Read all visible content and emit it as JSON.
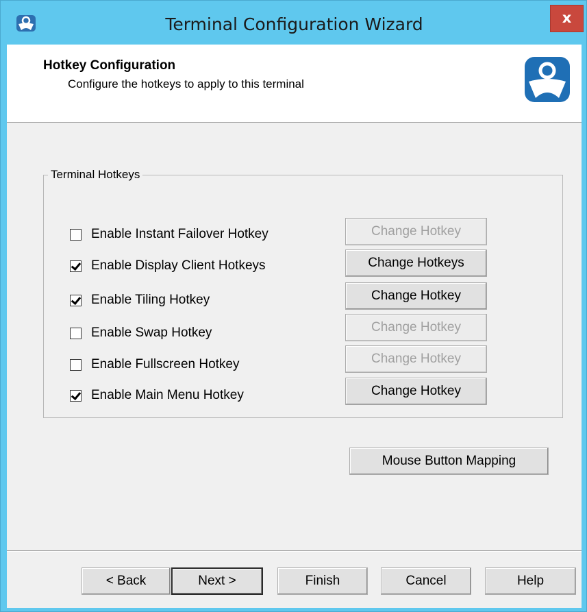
{
  "window": {
    "title": "Terminal Configuration Wizard",
    "close_label": "x"
  },
  "header": {
    "title": "Hotkey Configuration",
    "subtitle": "Configure the hotkeys to apply to this terminal"
  },
  "group": {
    "label": "Terminal Hotkeys",
    "rows": [
      {
        "label": "Enable Instant Failover Hotkey",
        "checked": false,
        "button": "Change Hotkey",
        "button_enabled": false
      },
      {
        "label": "Enable Display Client Hotkeys",
        "checked": true,
        "button": "Change Hotkeys",
        "button_enabled": true
      },
      {
        "label": "Enable Tiling Hotkey",
        "checked": true,
        "button": "Change Hotkey",
        "button_enabled": true
      },
      {
        "label": "Enable Swap Hotkey",
        "checked": false,
        "button": "Change Hotkey",
        "button_enabled": false
      },
      {
        "label": "Enable Fullscreen Hotkey",
        "checked": false,
        "button": "Change Hotkey",
        "button_enabled": false
      },
      {
        "label": "Enable Main Menu Hotkey",
        "checked": true,
        "button": "Change Hotkey",
        "button_enabled": true
      }
    ]
  },
  "mouse_button_mapping_label": "Mouse Button Mapping",
  "footer": {
    "back": "< Back",
    "next": "Next >",
    "finish": "Finish",
    "cancel": "Cancel",
    "help": "Help"
  },
  "colors": {
    "titlebar": "#5fc8ee",
    "close": "#c9483d",
    "logo_blue": "#1f6fb5"
  }
}
